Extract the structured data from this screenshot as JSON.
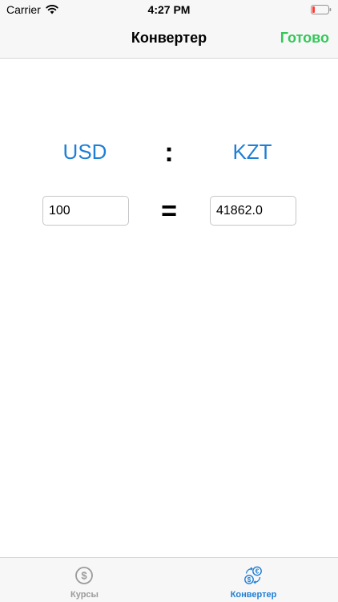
{
  "status_bar": {
    "carrier": "Carrier",
    "time": "4:27 PM"
  },
  "nav": {
    "title": "Конвертер",
    "done_label": "Готово"
  },
  "converter": {
    "from_currency": "USD",
    "to_currency": "KZT",
    "separator": ":",
    "equals": "=",
    "from_value": "100",
    "to_value": "41862.0"
  },
  "tabs": [
    {
      "label": "Курсы",
      "icon": "dollar-circle-icon",
      "selected": false
    },
    {
      "label": "Конвертер",
      "icon": "currency-exchange-icon",
      "selected": true
    }
  ],
  "colors": {
    "accent": "#1f7fd6",
    "done": "#34c759",
    "inactive_tab": "#9b9b9b",
    "battery_low": "#ff3b30"
  }
}
